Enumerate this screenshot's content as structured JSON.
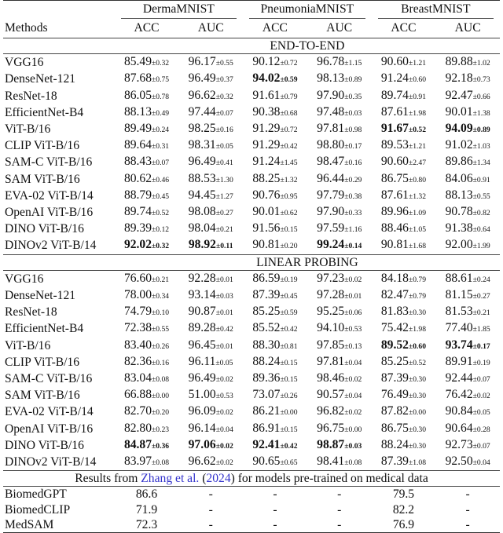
{
  "table": {
    "datasets": [
      "DermaMNIST",
      "PneumoniaMNIST",
      "BreastMNIST"
    ],
    "metric_labels": [
      "ACC",
      "AUC",
      "ACC",
      "AUC",
      "ACC",
      "AUC"
    ],
    "methods_header": "Methods",
    "sections": [
      {
        "label": "END-TO-END",
        "rows": [
          {
            "method": "VGG16",
            "cells": [
              {
                "v": "85.49",
                "s": "±0.32"
              },
              {
                "v": "96.17",
                "s": "±0.55"
              },
              {
                "v": "90.12",
                "s": "±0.72"
              },
              {
                "v": "96.78",
                "s": "±1.15"
              },
              {
                "v": "90.60",
                "s": "±1.21"
              },
              {
                "v": "89.88",
                "s": "±1.02"
              }
            ]
          },
          {
            "method": "DenseNet-121",
            "cells": [
              {
                "v": "87.68",
                "s": "±0.75"
              },
              {
                "v": "96.49",
                "s": "±0.37"
              },
              {
                "v": "94.02",
                "s": "±0.59",
                "b": true
              },
              {
                "v": "98.13",
                "s": "±0.89"
              },
              {
                "v": "91.24",
                "s": "±0.60"
              },
              {
                "v": "92.18",
                "s": "±0.73"
              }
            ]
          },
          {
            "method": "ResNet-18",
            "cells": [
              {
                "v": "86.05",
                "s": "±0.78"
              },
              {
                "v": "96.62",
                "s": "±0.32"
              },
              {
                "v": "91.61",
                "s": "±0.79"
              },
              {
                "v": "97.90",
                "s": "±0.35"
              },
              {
                "v": "89.74",
                "s": "±0.91"
              },
              {
                "v": "92.47",
                "s": "±0.66"
              }
            ]
          },
          {
            "method": "EfficientNet-B4",
            "cells": [
              {
                "v": "88.13",
                "s": "±0.49"
              },
              {
                "v": "97.44",
                "s": "±0.07"
              },
              {
                "v": "90.38",
                "s": "±0.68"
              },
              {
                "v": "97.48",
                "s": "±0.03"
              },
              {
                "v": "87.61",
                "s": "±1.98"
              },
              {
                "v": "90.01",
                "s": "±1.38"
              }
            ]
          },
          {
            "method": "ViT-B/16",
            "cells": [
              {
                "v": "89.49",
                "s": "±0.24"
              },
              {
                "v": "98.25",
                "s": "±0.16"
              },
              {
                "v": "91.29",
                "s": "±0.72"
              },
              {
                "v": "97.81",
                "s": "±0.98"
              },
              {
                "v": "91.67",
                "s": "±0.52",
                "b": true
              },
              {
                "v": "94.09",
                "s": "±0.89",
                "b": true
              }
            ]
          },
          {
            "method": "CLIP ViT-B/16",
            "cells": [
              {
                "v": "89.64",
                "s": "±0.31"
              },
              {
                "v": "98.31",
                "s": "±0.05"
              },
              {
                "v": "91.29",
                "s": "±0.42"
              },
              {
                "v": "98.80",
                "s": "±0.17"
              },
              {
                "v": "89.53",
                "s": "±1.21"
              },
              {
                "v": "91.02",
                "s": "±1.03"
              }
            ]
          },
          {
            "method": "SAM-C ViT-B/16",
            "cells": [
              {
                "v": "88.43",
                "s": "±0.07"
              },
              {
                "v": "96.49",
                "s": "±0.41"
              },
              {
                "v": "91.24",
                "s": "±1.45"
              },
              {
                "v": "98.47",
                "s": "±0.16"
              },
              {
                "v": "90.60",
                "s": "±2.47"
              },
              {
                "v": "89.86",
                "s": "±1.34"
              }
            ]
          },
          {
            "method": "SAM ViT-B/16",
            "cells": [
              {
                "v": "80.62",
                "s": "±0.46"
              },
              {
                "v": "88.53",
                "s": "±1.30"
              },
              {
                "v": "88.25",
                "s": "±1.32"
              },
              {
                "v": "96.44",
                "s": "±0.29"
              },
              {
                "v": "86.75",
                "s": "±0.80"
              },
              {
                "v": "84.06",
                "s": "±0.91"
              }
            ]
          },
          {
            "method": "EVA-02 ViT-B/14",
            "cells": [
              {
                "v": "88.79",
                "s": "±0.45"
              },
              {
                "v": "94.45",
                "s": "±1.27"
              },
              {
                "v": "90.76",
                "s": "±0.95"
              },
              {
                "v": "97.79",
                "s": "±0.38"
              },
              {
                "v": "87.61",
                "s": "±1.32"
              },
              {
                "v": "88.13",
                "s": "±0.55"
              }
            ]
          },
          {
            "method": "OpenAI ViT-B/16",
            "cells": [
              {
                "v": "89.74",
                "s": "±0.52"
              },
              {
                "v": "98.08",
                "s": "±0.27"
              },
              {
                "v": "90.01",
                "s": "±0.62"
              },
              {
                "v": "97.90",
                "s": "±0.33"
              },
              {
                "v": "89.96",
                "s": "±1.09"
              },
              {
                "v": "90.78",
                "s": "±0.82"
              }
            ]
          },
          {
            "method": "DINO ViT-B/16",
            "cells": [
              {
                "v": "89.39",
                "s": "±0.12"
              },
              {
                "v": "98.04",
                "s": "±0.21"
              },
              {
                "v": "91.56",
                "s": "±0.15"
              },
              {
                "v": "97.59",
                "s": "±1.16"
              },
              {
                "v": "88.46",
                "s": "±1.05"
              },
              {
                "v": "91.38",
                "s": "±0.64"
              }
            ]
          },
          {
            "method": "DINOv2 ViT-B/14",
            "cells": [
              {
                "v": "92.02",
                "s": "±0.32",
                "b": true
              },
              {
                "v": "98.92",
                "s": "±0.11",
                "b": true
              },
              {
                "v": "90.81",
                "s": "±0.20"
              },
              {
                "v": "99.24",
                "s": "±0.14",
                "b": true
              },
              {
                "v": "90.81",
                "s": "±1.68"
              },
              {
                "v": "92.00",
                "s": "±1.99"
              }
            ]
          }
        ]
      },
      {
        "label": "LINEAR PROBING",
        "rows": [
          {
            "method": "VGG16",
            "cells": [
              {
                "v": "76.60",
                "s": "±0.21"
              },
              {
                "v": "92.28",
                "s": "±0.01"
              },
              {
                "v": "86.59",
                "s": "±0.19"
              },
              {
                "v": "97.23",
                "s": "±0.02"
              },
              {
                "v": "84.18",
                "s": "±0.79"
              },
              {
                "v": "88.61",
                "s": "±0.24"
              }
            ]
          },
          {
            "method": "DenseNet-121",
            "cells": [
              {
                "v": "78.00",
                "s": "±0.34"
              },
              {
                "v": "93.14",
                "s": "±0.03"
              },
              {
                "v": "87.39",
                "s": "±0.45"
              },
              {
                "v": "97.28",
                "s": "±0.01"
              },
              {
                "v": "82.47",
                "s": "±0.79"
              },
              {
                "v": "81.15",
                "s": "±0.27"
              }
            ]
          },
          {
            "method": "ResNet-18",
            "cells": [
              {
                "v": "74.79",
                "s": "±0.10"
              },
              {
                "v": "90.87",
                "s": "±0.01"
              },
              {
                "v": "85.25",
                "s": "±0.59"
              },
              {
                "v": "95.25",
                "s": "±0.06"
              },
              {
                "v": "81.83",
                "s": "±0.30"
              },
              {
                "v": "81.53",
                "s": "±0.21"
              }
            ]
          },
          {
            "method": "EfficientNet-B4",
            "cells": [
              {
                "v": "72.38",
                "s": "±0.55"
              },
              {
                "v": "89.28",
                "s": "±0.42"
              },
              {
                "v": "85.52",
                "s": "±0.42"
              },
              {
                "v": "94.10",
                "s": "±0.53"
              },
              {
                "v": "75.42",
                "s": "±1.98"
              },
              {
                "v": "77.40",
                "s": "±1.85"
              }
            ]
          },
          {
            "method": "ViT-B/16",
            "cells": [
              {
                "v": "83.40",
                "s": "±0.26"
              },
              {
                "v": "96.45",
                "s": "±0.01"
              },
              {
                "v": "88.30",
                "s": "±0.81"
              },
              {
                "v": "97.85",
                "s": "±0.13"
              },
              {
                "v": "89.52",
                "s": "±0.60",
                "b": true
              },
              {
                "v": "93.74",
                "s": "±0.17",
                "b": true
              }
            ]
          },
          {
            "method": "CLIP ViT-B/16",
            "cells": [
              {
                "v": "82.36",
                "s": "±0.16"
              },
              {
                "v": "96.11",
                "s": "±0.05"
              },
              {
                "v": "88.24",
                "s": "±0.15"
              },
              {
                "v": "97.81",
                "s": "±0.04"
              },
              {
                "v": "85.25",
                "s": "±0.52"
              },
              {
                "v": "89.91",
                "s": "±0.19"
              }
            ]
          },
          {
            "method": "SAM-C ViT-B/16",
            "cells": [
              {
                "v": "83.04",
                "s": "±0.08"
              },
              {
                "v": "96.49",
                "s": "±0.02"
              },
              {
                "v": "89.36",
                "s": "±0.15"
              },
              {
                "v": "98.46",
                "s": "±0.02"
              },
              {
                "v": "87.39",
                "s": "±0.30"
              },
              {
                "v": "92.44",
                "s": "±0.07"
              }
            ]
          },
          {
            "method": "SAM ViT-B/16",
            "cells": [
              {
                "v": "66.88",
                "s": "±0.00"
              },
              {
                "v": "51.00",
                "s": "±0.53"
              },
              {
                "v": "73.07",
                "s": "±0.26"
              },
              {
                "v": "90.57",
                "s": "±0.04"
              },
              {
                "v": "76.49",
                "s": "±0.30"
              },
              {
                "v": "76.42",
                "s": "±0.02"
              }
            ]
          },
          {
            "method": "EVA-02 ViT-B/14",
            "cells": [
              {
                "v": "82.70",
                "s": "±0.20"
              },
              {
                "v": "96.09",
                "s": "±0.02"
              },
              {
                "v": "86.21",
                "s": "±0.00"
              },
              {
                "v": "96.82",
                "s": "±0.02"
              },
              {
                "v": "87.82",
                "s": "±0.00"
              },
              {
                "v": "90.84",
                "s": "±0.05"
              }
            ]
          },
          {
            "method": "OpenAI ViT-B/16",
            "cells": [
              {
                "v": "82.80",
                "s": "±0.23"
              },
              {
                "v": "96.14",
                "s": "±0.04"
              },
              {
                "v": "86.91",
                "s": "±0.15"
              },
              {
                "v": "96.75",
                "s": "±0.00"
              },
              {
                "v": "86.75",
                "s": "±0.30"
              },
              {
                "v": "90.64",
                "s": "±0.28"
              }
            ]
          },
          {
            "method": "DINO ViT-B/16",
            "cells": [
              {
                "v": "84.87",
                "s": "±0.36",
                "b": true
              },
              {
                "v": "97.06",
                "s": "±0.02",
                "b": true
              },
              {
                "v": "92.41",
                "s": "±0.42",
                "b": true
              },
              {
                "v": "98.87",
                "s": "±0.03",
                "b": true
              },
              {
                "v": "88.24",
                "s": "±0.30"
              },
              {
                "v": "92.73",
                "s": "±0.07"
              }
            ]
          },
          {
            "method": "DINOv2 ViT-B/14",
            "cells": [
              {
                "v": "83.97",
                "s": "±0.08"
              },
              {
                "v": "96.62",
                "s": "±0.02"
              },
              {
                "v": "90.65",
                "s": "±0.65"
              },
              {
                "v": "98.41",
                "s": "±0.08"
              },
              {
                "v": "87.39",
                "s": "±1.08"
              },
              {
                "v": "92.50",
                "s": "±0.04"
              }
            ]
          }
        ]
      }
    ],
    "external": {
      "label_prefix": "Results from ",
      "citation_author": "Zhang et al.",
      "citation_year": "2024",
      "label_suffix": " for models pre-trained on medical data",
      "rows": [
        {
          "method": "BiomedGPT",
          "cells": [
            "86.6",
            "-",
            "-",
            "-",
            "79.5",
            "-"
          ]
        },
        {
          "method": "BiomedCLIP",
          "cells": [
            "71.9",
            "-",
            "-",
            "-",
            "82.2",
            "-"
          ]
        },
        {
          "method": "MedSAM",
          "cells": [
            "72.3",
            "-",
            "-",
            "-",
            "76.9",
            "-"
          ]
        }
      ]
    },
    "colors": {
      "citation": "#3333cc",
      "rule": "#333333"
    }
  }
}
